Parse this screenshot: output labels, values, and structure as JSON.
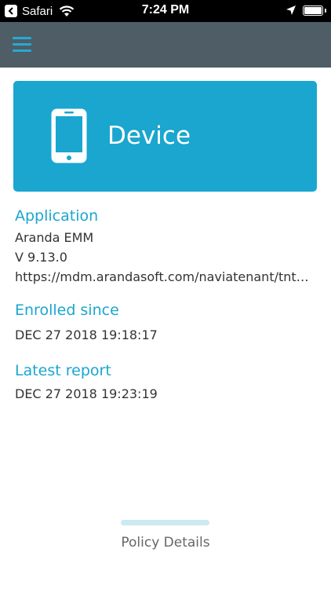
{
  "status_bar": {
    "back_app": "Safari",
    "time": "7:24 PM"
  },
  "nav": {
    "menu_icon": "hamburger-menu-icon"
  },
  "device_card": {
    "title": "Device",
    "icon": "smartphone-icon"
  },
  "application": {
    "label": "Application",
    "name": "Aranda EMM",
    "version": "V 9.13.0",
    "url": "https://mdm.arandasoft.com/naviatenant/tnts..."
  },
  "enrolled": {
    "label": "Enrolled since",
    "date": "DEC 27 2018 19:18:17"
  },
  "latest_report": {
    "label": "Latest report",
    "date": "DEC 27 2018 19:23:19"
  },
  "footer": {
    "policy_label": "Policy Details"
  },
  "colors": {
    "accent": "#1aa6cf",
    "nav_bg": "#4e5d66"
  }
}
